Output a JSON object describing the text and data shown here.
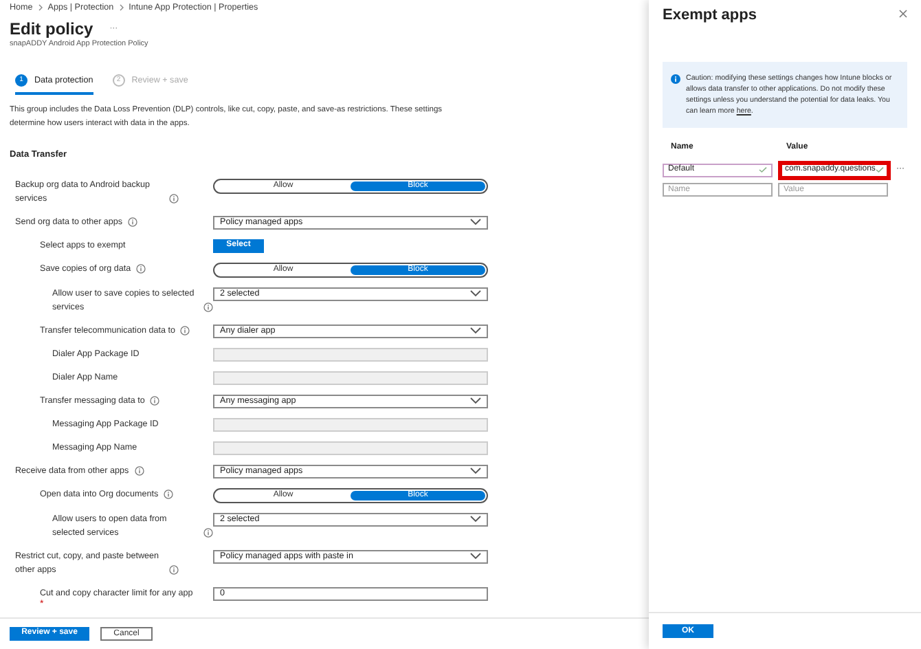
{
  "breadcrumb": [
    "Home",
    "Apps | Protection",
    "Intune App Protection | Properties"
  ],
  "page": {
    "title": "Edit policy",
    "more": "···",
    "subtitle": "snapADDY Android App Protection Policy"
  },
  "steps": [
    {
      "number": "1",
      "label": "Data protection",
      "selected": true
    },
    {
      "number": "2",
      "label": "Review + save",
      "selected": false
    }
  ],
  "description": "This group includes the Data Loss Prevention (DLP) controls, like cut, copy, paste, and save-as restrictions. These settings determine how users interact with data in the apps.",
  "section_title": "Data Transfer",
  "settings": [
    {
      "kind": "toggle",
      "label": "Backup org data to Android backup services",
      "info": true,
      "options": [
        {
          "label": "Allow",
          "selected": false
        },
        {
          "label": "Block",
          "selected": true
        }
      ]
    },
    {
      "kind": "dropdown",
      "label": "Send org data to other apps",
      "info": true,
      "value": "Policy managed apps",
      "children": [
        {
          "kind": "button",
          "label": "Select apps to exempt",
          "info": false,
          "value": "Select"
        },
        {
          "kind": "toggle",
          "label": "Save copies of org data",
          "info": true,
          "options": [
            {
              "label": "Allow",
              "selected": false
            },
            {
              "label": "Block",
              "selected": true
            }
          ],
          "children": [
            {
              "kind": "dropdown",
              "label": "Allow user to save copies to selected services",
              "info": true,
              "value": "2 selected"
            }
          ]
        },
        {
          "kind": "dropdown",
          "label": "Transfer telecommunication data to",
          "info": true,
          "value": "Any dialer app",
          "children": [
            {
              "kind": "field",
              "label": "Dialer App Package ID",
              "info": false,
              "disabled": true
            },
            {
              "kind": "field",
              "label": "Dialer App Name",
              "info": false,
              "disabled": true
            }
          ]
        },
        {
          "kind": "dropdown",
          "label": "Transfer messaging data to",
          "info": true,
          "value": "Any messaging app",
          "children": [
            {
              "kind": "field",
              "label": "Messaging App Package ID",
              "info": false,
              "disabled": true
            },
            {
              "kind": "field",
              "label": "Messaging App Name",
              "info": false,
              "disabled": true
            }
          ]
        }
      ]
    },
    {
      "kind": "dropdown",
      "label": "Receive data from other apps",
      "info": true,
      "value": "Policy managed apps",
      "children": [
        {
          "kind": "toggle",
          "label": "Open data into Org documents",
          "info": true,
          "options": [
            {
              "label": "Allow",
              "selected": false
            },
            {
              "label": "Block",
              "selected": true
            }
          ],
          "children": [
            {
              "kind": "dropdown",
              "label": "Allow users to open data from selected services",
              "info": true,
              "value": "2 selected"
            }
          ]
        }
      ]
    },
    {
      "kind": "dropdown",
      "label": "Restrict cut, copy, and paste between other apps",
      "info": true,
      "value": "Policy managed apps with paste in",
      "children": [
        {
          "kind": "field",
          "label": "Cut and copy character limit for any app",
          "info": false,
          "disabled": false,
          "value": "0",
          "required_mark": "*"
        }
      ]
    }
  ],
  "footer_buttons": [
    {
      "label": "Review + save",
      "primary": true
    },
    {
      "label": "Cancel",
      "primary": false
    }
  ],
  "panel": {
    "title": "Exempt apps",
    "notice": {
      "text": "Caution: modifying these settings changes how Intune blocks or allows data transfer to other applications. Do not modify these settings unless you understand the potential for data leaks. You can learn more ",
      "link": "here",
      "suffix": "."
    },
    "columns": [
      "Name",
      "Value"
    ],
    "rows": [
      {
        "name": "Default",
        "value": "com.snapaddy.questions",
        "highlighted": true
      }
    ],
    "new_row": {
      "name_placeholder": "Name",
      "value_placeholder": "Value"
    },
    "ok_button": "OK"
  }
}
